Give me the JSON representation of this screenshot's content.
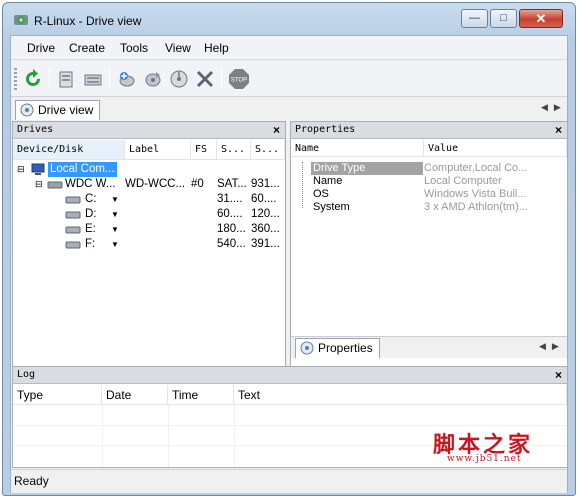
{
  "window": {
    "title": "R-Linux - Drive view",
    "min_glyph": "—",
    "max_glyph": "□",
    "close_glyph": "✕"
  },
  "menu": [
    "Drive",
    "Create",
    "Tools",
    "View",
    "Help"
  ],
  "toolbar": {
    "icons": [
      "refresh-icon",
      "open-image-icon",
      "create-image-icon",
      "scan-icon",
      "recover-icon",
      "disk-icon",
      "remove-icon",
      "stop-icon"
    ],
    "stop_label": "STOP"
  },
  "tabs": {
    "main": "Drive view",
    "properties": "Properties"
  },
  "drives": {
    "title": "Drives",
    "close": "×",
    "columns": [
      "Device/Disk",
      "Label",
      "FS",
      "S...",
      "S..."
    ],
    "rows": [
      {
        "name": "Local Com...",
        "label": "",
        "fs": "",
        "s1": "",
        "s2": "",
        "selected": true
      },
      {
        "name": "WDC W...",
        "label": "WD-WCC...",
        "fs": "#0",
        "s1": "SAT...",
        "s2": "931..."
      },
      {
        "name": "C:",
        "label": "",
        "fs": "",
        "s1": "31....",
        "s2": "60...."
      },
      {
        "name": "D:",
        "label": "",
        "fs": "",
        "s1": "60....",
        "s2": "120..."
      },
      {
        "name": "E:",
        "label": "",
        "fs": "",
        "s1": "180...",
        "s2": "360..."
      },
      {
        "name": "F:",
        "label": "",
        "fs": "",
        "s1": "540...",
        "s2": "391..."
      }
    ]
  },
  "properties": {
    "title": "Properties",
    "close": "×",
    "columns": [
      "Name",
      "Value"
    ],
    "rows": [
      {
        "name": "Drive Type",
        "value": "Computer,Local Co...",
        "highlight": true
      },
      {
        "name": "Name",
        "value": "Local Computer"
      },
      {
        "name": "OS",
        "value": "Windows Vista Buil..."
      },
      {
        "name": "System",
        "value": "3 x AMD Athlon(tm)..."
      }
    ]
  },
  "log": {
    "title": "Log",
    "close": "×",
    "columns": [
      "Type",
      "Date",
      "Time",
      "Text"
    ]
  },
  "status": "Ready",
  "watermark": {
    "text": "脚本之家",
    "url": "www.jb51.net"
  },
  "colors": {
    "selection": "#3399ff",
    "accent_green": "#2e9c3a",
    "watermark_red": "#c9161e"
  }
}
